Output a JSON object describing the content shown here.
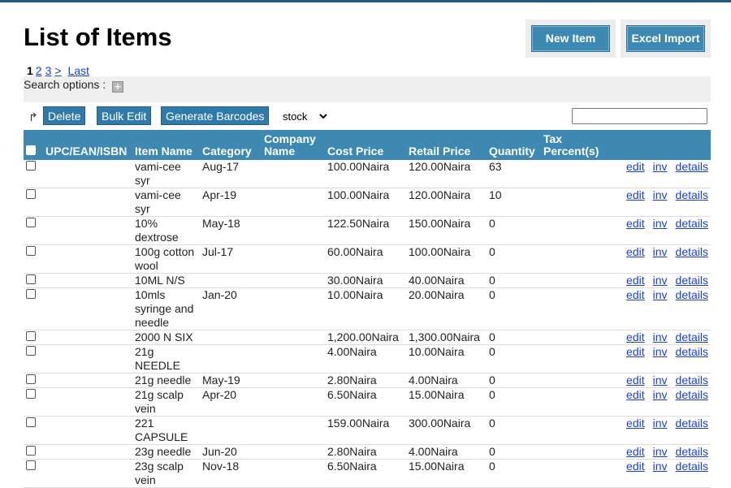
{
  "page": {
    "title": "List of Items"
  },
  "header_buttons": {
    "new_item": "New Item",
    "excel_import": "Excel Import"
  },
  "pagination": {
    "current": "1",
    "pages": [
      "2",
      "3",
      ">"
    ],
    "last": "Last"
  },
  "search": {
    "label": "Search options :"
  },
  "toolbar": {
    "delete": "Delete",
    "bulk_edit": "Bulk Edit",
    "generate_barcodes": "Generate Barcodes",
    "stock_select_value": "stock",
    "filter_value": ""
  },
  "table": {
    "columns": [
      "",
      "UPC/EAN/ISBN",
      "Item Name",
      "Category",
      "Company Name",
      "Cost Price",
      "Retail Price",
      "Quantity",
      "Tax Percent(s)",
      ""
    ],
    "actions": [
      "edit",
      "inv",
      "details"
    ],
    "rows": [
      {
        "upc": "",
        "name": "vami-cee syr",
        "category": "Aug-17",
        "company": "",
        "cost": "100.00Naira",
        "retail": "120.00Naira",
        "qty": "63",
        "tax": ""
      },
      {
        "upc": "",
        "name": "vami-cee syr",
        "category": "Apr-19",
        "company": "",
        "cost": "100.00Naira",
        "retail": "120.00Naira",
        "qty": "10",
        "tax": ""
      },
      {
        "upc": "",
        "name": "10% dextrose",
        "category": "May-18",
        "company": "",
        "cost": "122.50Naira",
        "retail": "150.00Naira",
        "qty": "0",
        "tax": ""
      },
      {
        "upc": "",
        "name": "100g cotton wool",
        "category": "Jul-17",
        "company": "",
        "cost": "60.00Naira",
        "retail": "100.00Naira",
        "qty": "0",
        "tax": ""
      },
      {
        "upc": "",
        "name": "10ML N/S",
        "category": "",
        "company": "",
        "cost": "30.00Naira",
        "retail": "40.00Naira",
        "qty": "0",
        "tax": ""
      },
      {
        "upc": "",
        "name": "10mls syringe and needle",
        "category": "Jan-20",
        "company": "",
        "cost": "10.00Naira",
        "retail": "20.00Naira",
        "qty": "0",
        "tax": ""
      },
      {
        "upc": "",
        "name": "2000 N SIX",
        "category": "",
        "company": "",
        "cost": "1,200.00Naira",
        "retail": "1,300.00Naira",
        "qty": "0",
        "tax": ""
      },
      {
        "upc": "",
        "name": "21g NEEDLE",
        "category": "",
        "company": "",
        "cost": "4.00Naira",
        "retail": "10.00Naira",
        "qty": "0",
        "tax": ""
      },
      {
        "upc": "",
        "name": "21g needle",
        "category": "May-19",
        "company": "",
        "cost": "2.80Naira",
        "retail": "4.00Naira",
        "qty": "0",
        "tax": ""
      },
      {
        "upc": "",
        "name": "21g scalp vein",
        "category": "Apr-20",
        "company": "",
        "cost": "6.50Naira",
        "retail": "15.00Naira",
        "qty": "0",
        "tax": ""
      },
      {
        "upc": "",
        "name": "221 CAPSULE",
        "category": "",
        "company": "",
        "cost": "159.00Naira",
        "retail": "300.00Naira",
        "qty": "0",
        "tax": ""
      },
      {
        "upc": "",
        "name": "23g needle",
        "category": "Jun-20",
        "company": "",
        "cost": "2.80Naira",
        "retail": "4.00Naira",
        "qty": "0",
        "tax": ""
      },
      {
        "upc": "",
        "name": "23g scalp vein",
        "category": "Nov-18",
        "company": "",
        "cost": "6.50Naira",
        "retail": "15.00Naira",
        "qty": "0",
        "tax": ""
      }
    ]
  },
  "colors": {
    "header_blue": "#3e89b1",
    "button_blue": "#2f7aa8",
    "link_blue": "#1a3fd6",
    "top_rule": "#1e5c86"
  },
  "icons": {
    "add_search_option": "plus-icon",
    "toolbar_corner": "corner-arrow-icon"
  }
}
